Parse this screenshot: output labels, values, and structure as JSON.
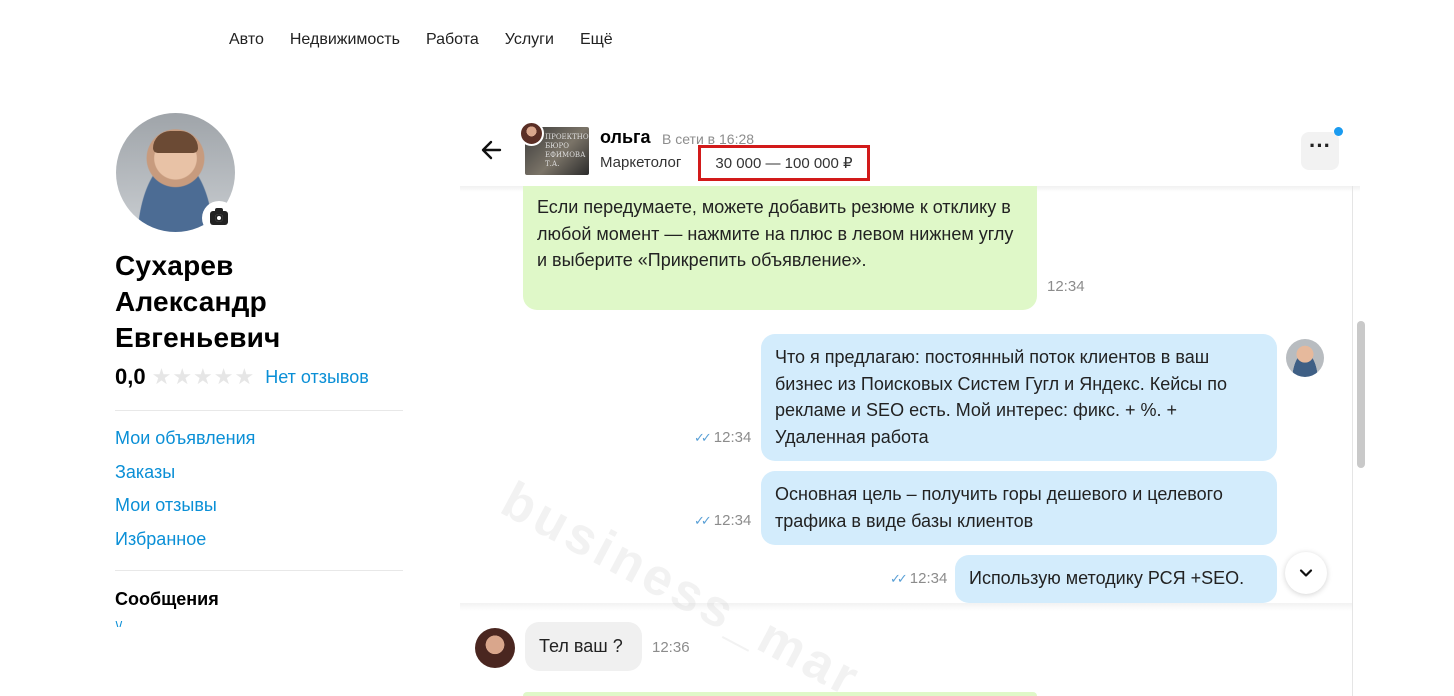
{
  "topnav": {
    "items": [
      "Авто",
      "Недвижимость",
      "Работа",
      "Услуги",
      "Ещё"
    ]
  },
  "profile": {
    "name_line1": "Сухарев",
    "name_line2": "Александр",
    "name_line3": "Евгеньевич",
    "rating": "0,0",
    "stars": "★★★★★",
    "reviews_link": "Нет отзывов",
    "menu": [
      "Мои объявления",
      "Заказы",
      "Мои отзывы",
      "Избранное"
    ],
    "messages_heading": "Сообщения"
  },
  "chat": {
    "avatar_text": "ПРОЕКТНОЕ БЮРО ЕФИМОВА Т.А.",
    "contact_name": "ольга",
    "status": "В сети в 16:28",
    "role": "Маркетолог",
    "salary": "30 000 — 100 000 ₽",
    "more_label": "···",
    "messages": [
      {
        "text": "Если передумаете, можете добавить резюме к отклику в любой момент — нажмите на плюс в левом нижнем углу и выберите «Прикрепить объявление».",
        "time": "12:34"
      },
      {
        "text": "Что я предлагаю: постоянный поток клиентов в ваш бизнес из Поисковых Систем Гугл и Яндекс. Кейсы по рекламе и SEO есть. Мой интерес: фикс. + %. + Удаленная работа",
        "time": "12:34"
      },
      {
        "text": "Основная цель – получить горы дешевого и целевого трафика в виде базы клиентов",
        "time": "12:34"
      },
      {
        "text": "Использую методику РСЯ +SEO.",
        "time": "12:34"
      },
      {
        "text": "Тел ваш ?",
        "time": "12:36"
      }
    ]
  },
  "watermark": "business_mar",
  "colors": {
    "link": "#0a8fd6",
    "incoming_bubble": "#dff8c8",
    "outgoing_bubble": "#d3ecfc",
    "highlight_box": "#d21a1a"
  }
}
